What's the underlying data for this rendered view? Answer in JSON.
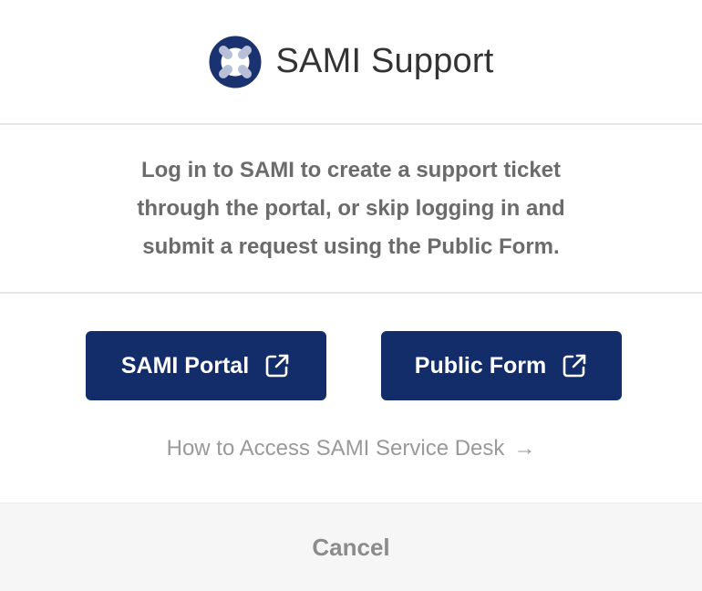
{
  "header": {
    "title": "SAMI Support",
    "logo_icon": "lifebuoy-icon",
    "logo_colors": {
      "ring": "#1a3270",
      "stripes": "#b7c0d8"
    }
  },
  "description": {
    "text": "Log in to SAMI to create a support ticket through the portal, or skip logging in and submit a request using the Public Form."
  },
  "actions": {
    "portal_label": "SAMI Portal",
    "portal_icon": "external-link-icon",
    "public_label": "Public Form",
    "public_icon": "external-link-icon",
    "button_color": "#132d6b",
    "howto_label": "How to Access SAMI Service Desk",
    "howto_arrow": "→"
  },
  "footer": {
    "cancel_label": "Cancel"
  }
}
